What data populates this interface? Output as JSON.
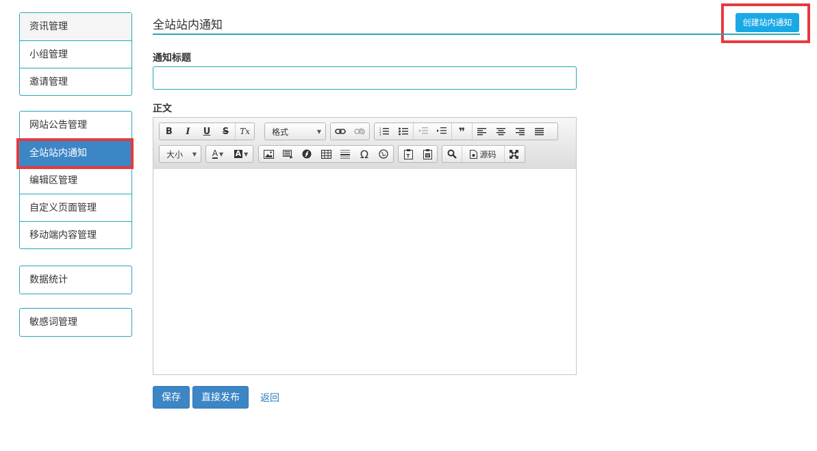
{
  "sidebar": {
    "groups": [
      {
        "items": [
          {
            "label": "资讯管理"
          },
          {
            "label": "小组管理"
          },
          {
            "label": "邀请管理"
          }
        ]
      },
      {
        "items": [
          {
            "label": "网站公告管理"
          },
          {
            "label": "全站站内通知"
          },
          {
            "label": "编辑区管理"
          },
          {
            "label": "自定义页面管理"
          },
          {
            "label": "移动端内容管理"
          }
        ]
      },
      {
        "items": [
          {
            "label": "数据统计"
          }
        ]
      },
      {
        "items": [
          {
            "label": "敏感词管理"
          }
        ]
      }
    ],
    "active_item": "全站站内通知"
  },
  "header": {
    "title": "全站站内通知",
    "create_button": "创建站内通知"
  },
  "form": {
    "title_label": "通知标题",
    "title_value": "",
    "body_label": "正文"
  },
  "editor": {
    "toolbar": {
      "bold": "B",
      "italic": "I",
      "underline": "U",
      "strike": "S",
      "remove_format": "Tx",
      "format_combo": "格式",
      "size_combo": "大小",
      "special_char": "Ω",
      "source_label": "源码"
    },
    "content": ""
  },
  "actions": {
    "save": "保存",
    "publish": "直接发布",
    "back": "返回"
  },
  "colors": {
    "accent": "#27a5be",
    "active": "#3d86c6",
    "create_button": "#1ba9e6",
    "highlight": "#e6393d"
  }
}
